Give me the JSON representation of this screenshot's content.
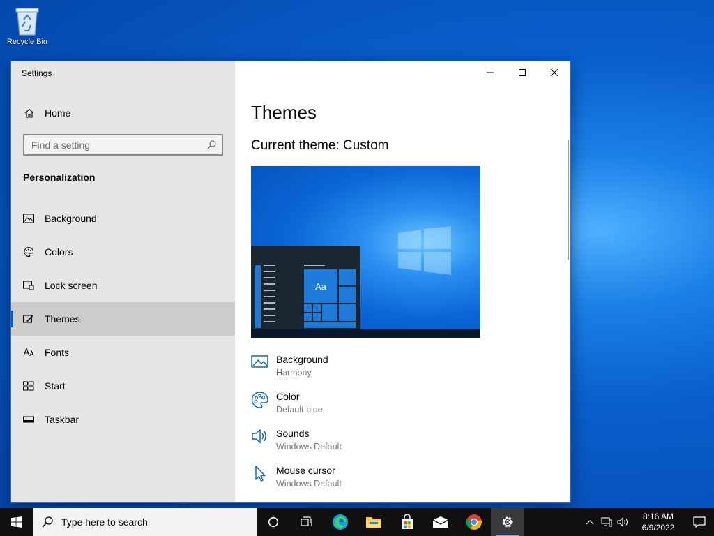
{
  "desktop": {
    "recycle_bin_label": "Recycle Bin"
  },
  "window": {
    "app_title": "Settings",
    "home_label": "Home",
    "search_placeholder": "Find a setting",
    "section_title": "Personalization",
    "nav": [
      {
        "label": "Background",
        "icon": "picture-icon"
      },
      {
        "label": "Colors",
        "icon": "palette-icon"
      },
      {
        "label": "Lock screen",
        "icon": "lock-screen-icon"
      },
      {
        "label": "Themes",
        "icon": "themes-icon",
        "active": true
      },
      {
        "label": "Fonts",
        "icon": "fonts-icon"
      },
      {
        "label": "Start",
        "icon": "start-icon"
      },
      {
        "label": "Taskbar",
        "icon": "taskbar-icon"
      }
    ]
  },
  "main": {
    "page_title": "Themes",
    "current_theme": "Current theme: Custom",
    "preview_sample_text": "Aa",
    "settings": [
      {
        "label": "Background",
        "value": "Harmony",
        "icon": "picture-icon"
      },
      {
        "label": "Color",
        "value": "Default blue",
        "icon": "palette-icon"
      },
      {
        "label": "Sounds",
        "value": "Windows Default",
        "icon": "speaker-icon"
      },
      {
        "label": "Mouse cursor",
        "value": "Windows Default",
        "icon": "cursor-icon"
      }
    ]
  },
  "taskbar": {
    "search_placeholder": "Type here to search",
    "time": "8:16 AM",
    "date": "6/9/2022"
  },
  "colors": {
    "accent": "#0063b1",
    "sidebar": "#e6e6e6",
    "taskbar": "#101010"
  }
}
